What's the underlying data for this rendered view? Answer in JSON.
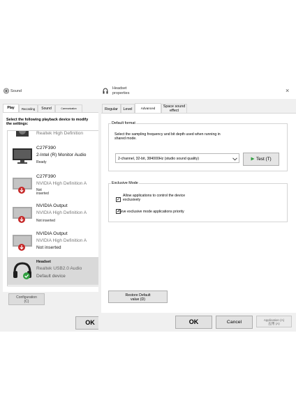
{
  "sound": {
    "title": "Sound",
    "tabs": [
      "Play",
      "Recording",
      "Sound",
      "Communication"
    ],
    "instruction": "Select the following playback device to modify the settings:",
    "devices": [
      {
        "name": "",
        "sub": "Realtek High Definition",
        "status": "",
        "icon": "speaker-icon"
      },
      {
        "name": "C27F390",
        "sub": "2-Intel (R) Monitor Audio",
        "status": "Ready",
        "icon": "monitor-icon"
      },
      {
        "name": "C27F390",
        "sub": "NVIDIA High Definition A",
        "status": "Not inserted",
        "icon": "monitor-disconnected-icon"
      },
      {
        "name": "NVIDIA Output",
        "sub": "NVIDIA High Definition A",
        "status": "Not inserted",
        "icon": "monitor-disconnected-icon"
      },
      {
        "name": "NVIDIA Output",
        "sub": "NVIDIA High Definition A",
        "status": "Not inserted",
        "icon": "monitor-disconnected-icon"
      },
      {
        "name": "Headset",
        "sub": "Realtek USB2.0 Audio",
        "status": "Default device",
        "icon": "headset-default-icon"
      }
    ],
    "configure_label_1": "Configuration",
    "configure_label_2": "(C)",
    "ok_label": "OK"
  },
  "props": {
    "title_line1": "Headset",
    "title_line2": "properties",
    "tabs": [
      "Regular",
      "Level",
      "Advanced",
      "Space sound effect"
    ],
    "default_format": {
      "legend": "Default format",
      "description": "Select the sampling frequency and bit depth used when running in shared mode.",
      "selected_format": "2-channel, 32-bit, 384000Hz (studio sound quality)",
      "test_label": "Test (T)"
    },
    "exclusive_mode": {
      "legend": "Exclusive Mode",
      "allow_label": "Allow applications to control the device exclusively",
      "allow_checked": true,
      "priority_label": "Give exclusive mode applications priority",
      "priority_checked": true
    },
    "restore_label_1": "Restore Default",
    "restore_label_2": "value (D)",
    "ok_label": "OK",
    "cancel_label": "Cancel",
    "apply_label_1": "Application (A)",
    "apply_label_2": "应用 (A)",
    "close_glyph": "×"
  }
}
